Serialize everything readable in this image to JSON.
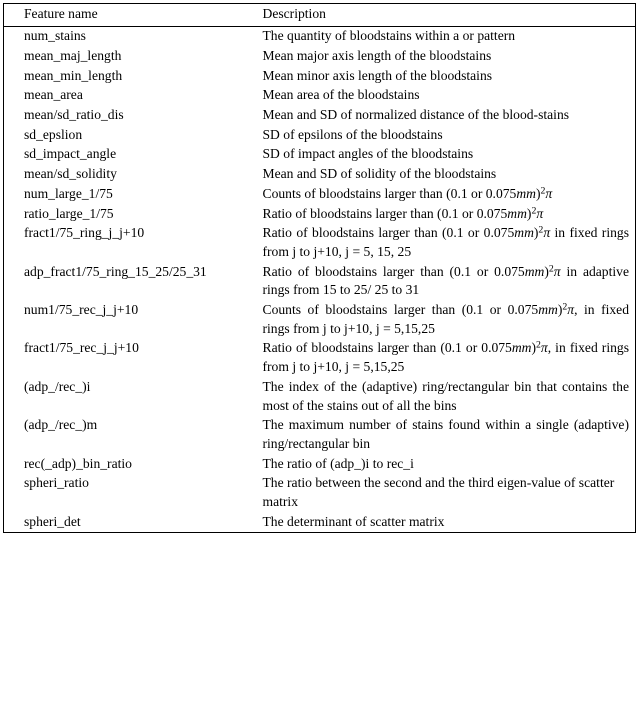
{
  "table": {
    "columns": [
      {
        "key": "feature",
        "label": "Feature name"
      },
      {
        "key": "description",
        "label": "Description"
      }
    ],
    "rows": [
      {
        "feature": "num_stains",
        "description": "The quantity of bloodstains within a or pattern",
        "justified": false
      },
      {
        "feature": "mean_maj_length",
        "description": "Mean major axis length of the bloodstains",
        "justified": false
      },
      {
        "feature": "mean_min_length",
        "description": "Mean minor axis length of the bloodstains",
        "justified": false
      },
      {
        "feature": "mean_area",
        "description": "Mean area of the bloodstains",
        "justified": false
      },
      {
        "feature": "mean/sd_ratio_dis",
        "description": "Mean and SD of normalized distance of the blood-stains",
        "justified": false
      },
      {
        "feature": "sd_epslion",
        "description": "SD of epsilons of the bloodstains",
        "justified": false
      },
      {
        "feature": "sd_impact_angle",
        "description": "SD of impact angles of the bloodstains",
        "justified": false
      },
      {
        "feature": "mean/sd_solidity",
        "description": "Mean and SD of solidity of the bloodstains",
        "justified": false
      },
      {
        "feature": "num_large_1/75",
        "description": "Counts of bloodstains larger than (0.1 or 0.075mm)^2 pi",
        "justified": true
      },
      {
        "feature": "ratio_large_1/75",
        "description": "Ratio of bloodstains larger than (0.1 or 0.075mm)^2 pi",
        "justified": true
      },
      {
        "feature": "fract1/75_ring_j_j+10",
        "description": "Ratio of bloodstains larger than (0.1 or 0.075mm)^2 pi in fixed rings from j to j+10, j = 5, 15, 25",
        "justified": true
      },
      {
        "feature": "adp_fract1/75_ring_15_25/25_31",
        "description": "Ratio of bloodstains larger than (0.1 or 0.075mm)^2 pi in adaptive rings from 15 to 25/ 25 to 31",
        "justified": true
      },
      {
        "feature": "num1/75_rec_j_j+10",
        "description": "Counts of bloodstains larger than (0.1 or 0.075mm)^2 pi, in fixed rings from j to j+10, j = 5,15,25",
        "justified": true
      },
      {
        "feature": "fract1/75_rec_j_j+10",
        "description": "Ratio of bloodstains larger than (0.1 or 0.075mm)^2 pi, in fixed rings from j to j+10, j = 5,15,25",
        "justified": true
      },
      {
        "feature": "(adp_/rec_)i",
        "description": "The index of the (adaptive) ring/rectangular bin that contains the most of the stains out of all the bins",
        "justified": true
      },
      {
        "feature": "(adp_/rec_)m",
        "description": "The maximum number of stains found within a single (adaptive) ring/rectangular bin",
        "justified": true
      },
      {
        "feature": "rec(_adp)_bin_ratio",
        "description": "The ratio of (adp_)i to rec_i",
        "justified": false
      },
      {
        "feature": "spheri_ratio",
        "description": "The ratio between the second and the third eigen-value of scatter matrix",
        "justified": false
      },
      {
        "feature": "spheri_det",
        "description": "The determinant of scatter matrix",
        "justified": false
      }
    ]
  }
}
